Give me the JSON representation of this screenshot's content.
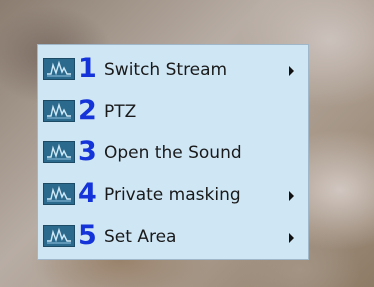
{
  "context_menu": {
    "items": [
      {
        "number": "1",
        "label": "Switch Stream",
        "has_submenu": true,
        "icon": "waveform-icon"
      },
      {
        "number": "2",
        "label": "PTZ",
        "has_submenu": false,
        "icon": "waveform-icon"
      },
      {
        "number": "3",
        "label": "Open the Sound",
        "has_submenu": false,
        "icon": "waveform-icon"
      },
      {
        "number": "4",
        "label": "Private masking",
        "has_submenu": true,
        "icon": "waveform-icon"
      },
      {
        "number": "5",
        "label": "Set Area",
        "has_submenu": true,
        "icon": "waveform-icon"
      }
    ],
    "colors": {
      "background": "#cfe6f5",
      "number": "#1433d8",
      "icon_bg": "#2b6a8c"
    }
  }
}
